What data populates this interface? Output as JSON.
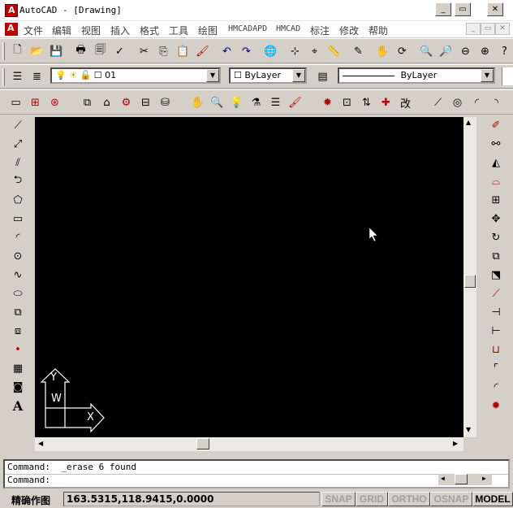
{
  "window": {
    "title": "AutoCAD - [Drawing]",
    "minimize": "_",
    "restore": "▭",
    "close": "✕"
  },
  "menubar": {
    "items": [
      "文件",
      "编辑",
      "视图",
      "插入",
      "格式",
      "工具",
      "绘图",
      "HMCADAPD",
      "HMCAD",
      "标注",
      "修改",
      "帮助"
    ]
  },
  "layer_toolbar": {
    "layer_value": "01",
    "color_value": "ByLayer",
    "linetype_value": "ByLayer"
  },
  "canvas": {
    "background": "#000000",
    "ucs_y_label": "Y",
    "ucs_w_label": "W",
    "ucs_x_label": "X"
  },
  "command": {
    "history": "Command:  _erase 6 found",
    "prompt": "Command:"
  },
  "status": {
    "label": "精确作图",
    "coordinates": "163.5315,118.9415,0.0000",
    "snap": "SNAP",
    "grid": "GRID",
    "ortho": "ORTHO",
    "osnap": "OSNAP",
    "model": "MODEL"
  }
}
